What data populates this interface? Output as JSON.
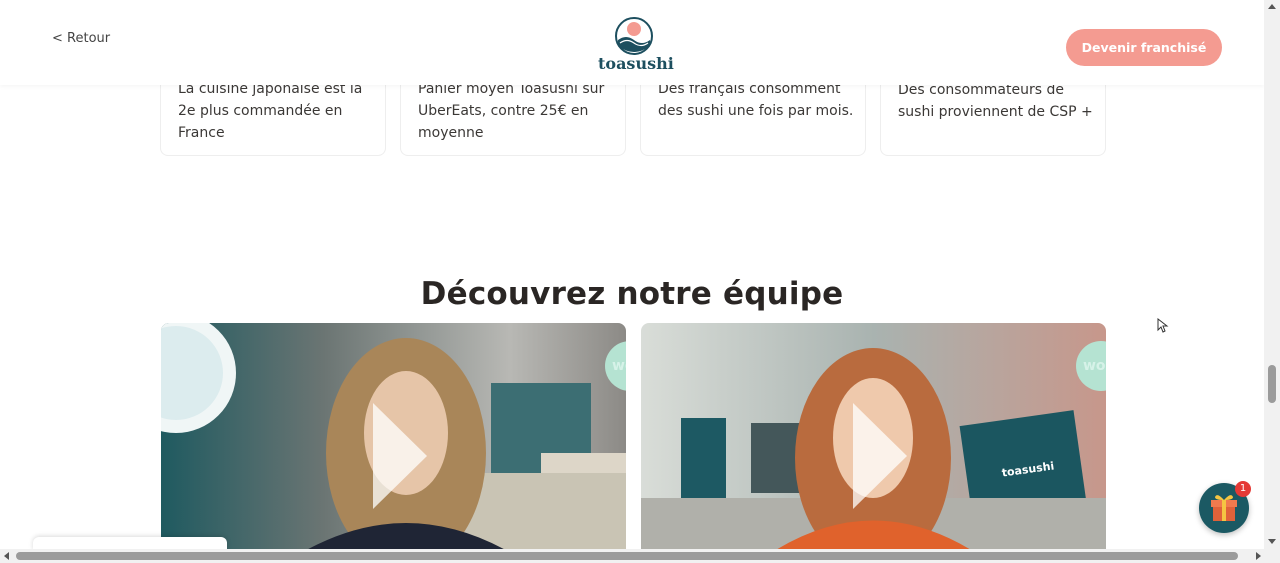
{
  "header": {
    "back_label": "< Retour",
    "logo_text": "toasushi",
    "cta_label": "Devenir franchisé"
  },
  "stats": [
    {
      "text": "La cuisine japonaise est la 2e plus commandée en France"
    },
    {
      "text": "Panier moyen Toasushi sur UberEats, contre 25€ en moyenne"
    },
    {
      "text": "Des français consomment des sushi une fois par mois."
    },
    {
      "text": "Des consommateurs de sushi proviennent de CSP +"
    }
  ],
  "team": {
    "title": "Découvrez notre équipe",
    "video_badge": "wo",
    "menu_sign": "toasushi"
  },
  "floating": {
    "gift_icon": "gift-icon",
    "gift_count": "1"
  },
  "colors": {
    "accent": "#f49b91",
    "brand_teal": "#1d4f5f"
  }
}
